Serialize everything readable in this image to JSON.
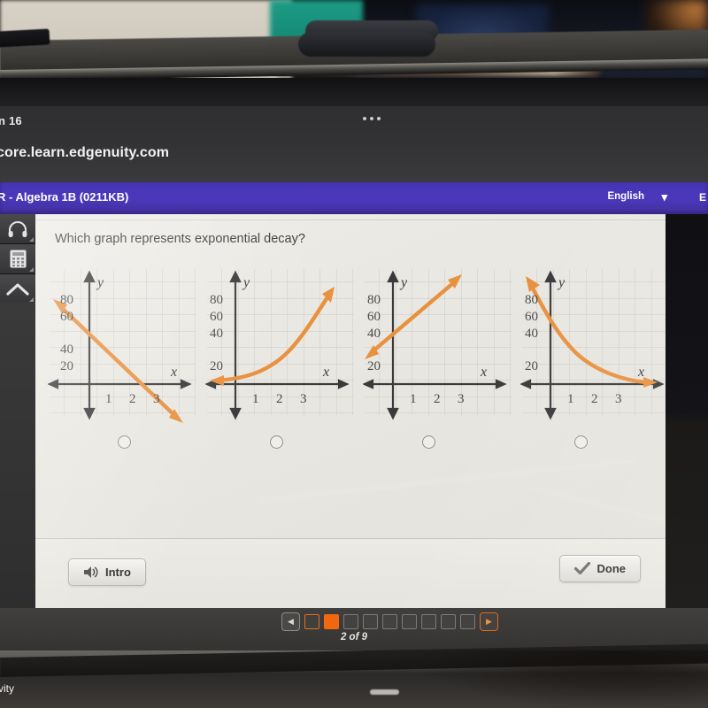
{
  "browser": {
    "tab_title": "n 16",
    "menu_icon": "ellipsis-icon",
    "url": "core.learn.edgenuity.com"
  },
  "appbar": {
    "course_title": "R - Algebra 1B (0211KB)",
    "language": "English",
    "language_chevron": "chevron-down-icon",
    "right_partial": "E"
  },
  "rail": {
    "items": [
      {
        "icon": "headphones-icon",
        "name": "audio-tool"
      },
      {
        "icon": "calculator-icon",
        "name": "calculator-tool"
      },
      {
        "icon": "up-arrow-icon",
        "name": "scroll-up-tool"
      }
    ]
  },
  "lesson": {
    "question": "Which graph represents exponential decay?",
    "choices": [
      {
        "id": "A",
        "selected": false
      },
      {
        "id": "B",
        "selected": false
      },
      {
        "id": "C",
        "selected": false
      },
      {
        "id": "D",
        "selected": false
      }
    ],
    "intro_label": "Intro",
    "intro_icon": "speaker-icon",
    "done_label": "Done",
    "done_icon": "check-icon"
  },
  "pager": {
    "prev_icon": "triangle-left-icon",
    "next_icon": "triangle-right-icon",
    "total": 9,
    "current": 2,
    "label": "2 of 9",
    "boxes": [
      "outline",
      "filled",
      "empty",
      "empty",
      "empty",
      "empty",
      "empty",
      "empty",
      "empty"
    ]
  },
  "photo": {
    "bottom_partial_text": "vity"
  },
  "colors": {
    "appbar_purple": "#4634b4",
    "curve_orange": "#e8913f",
    "pager_orange": "#f4660d",
    "panel_bg": "#eeece7",
    "axis_dark": "#3a3a3a"
  },
  "chart_data": [
    {
      "type": "line",
      "name": "graph-a",
      "title": "",
      "xlabel": "x",
      "ylabel": "y",
      "xticks": [
        1,
        2,
        3
      ],
      "yticks": [
        20,
        40,
        60,
        80
      ],
      "xlim": [
        -1.2,
        4.2
      ],
      "ylim": [
        -25,
        100
      ],
      "grid": true,
      "description": "decreasing straight line (linear decay)",
      "x": [
        -0.9,
        3.6
      ],
      "y": [
        92,
        -22
      ]
    },
    {
      "type": "line",
      "name": "graph-b",
      "title": "",
      "xlabel": "x",
      "ylabel": "y",
      "xticks": [
        1,
        2,
        3
      ],
      "yticks": [
        20,
        40,
        60,
        80
      ],
      "xlim": [
        -1.2,
        4.2
      ],
      "ylim": [
        -25,
        100
      ],
      "grid": true,
      "description": "exponential growth curve",
      "x": [
        -1.1,
        -0.5,
        0,
        0.5,
        1,
        1.5,
        2,
        2.5,
        3,
        3.4
      ],
      "y": [
        1,
        2,
        4,
        6,
        9,
        14,
        22,
        34,
        54,
        78
      ]
    },
    {
      "type": "line",
      "name": "graph-c",
      "title": "",
      "xlabel": "x",
      "ylabel": "y",
      "xticks": [
        1,
        2,
        3
      ],
      "yticks": [
        20,
        40,
        60,
        80
      ],
      "xlim": [
        -1.2,
        4.2
      ],
      "ylim": [
        -25,
        100
      ],
      "grid": true,
      "description": "increasing straight line (linear growth)",
      "x": [
        -1.1,
        2.4
      ],
      "y": [
        22,
        100
      ]
    },
    {
      "type": "line",
      "name": "graph-d",
      "title": "",
      "xlabel": "x",
      "ylabel": "y",
      "xticks": [
        1,
        2,
        3
      ],
      "yticks": [
        20,
        40,
        60,
        80
      ],
      "xlim": [
        -1.2,
        4.2
      ],
      "ylim": [
        -25,
        100
      ],
      "grid": true,
      "description": "exponential decay curve",
      "x": [
        -0.9,
        -0.5,
        0,
        0.5,
        1,
        1.5,
        2,
        2.5,
        3,
        3.5
      ],
      "y": [
        98,
        80,
        55,
        38,
        26,
        17,
        11,
        7,
        4,
        2
      ]
    }
  ]
}
